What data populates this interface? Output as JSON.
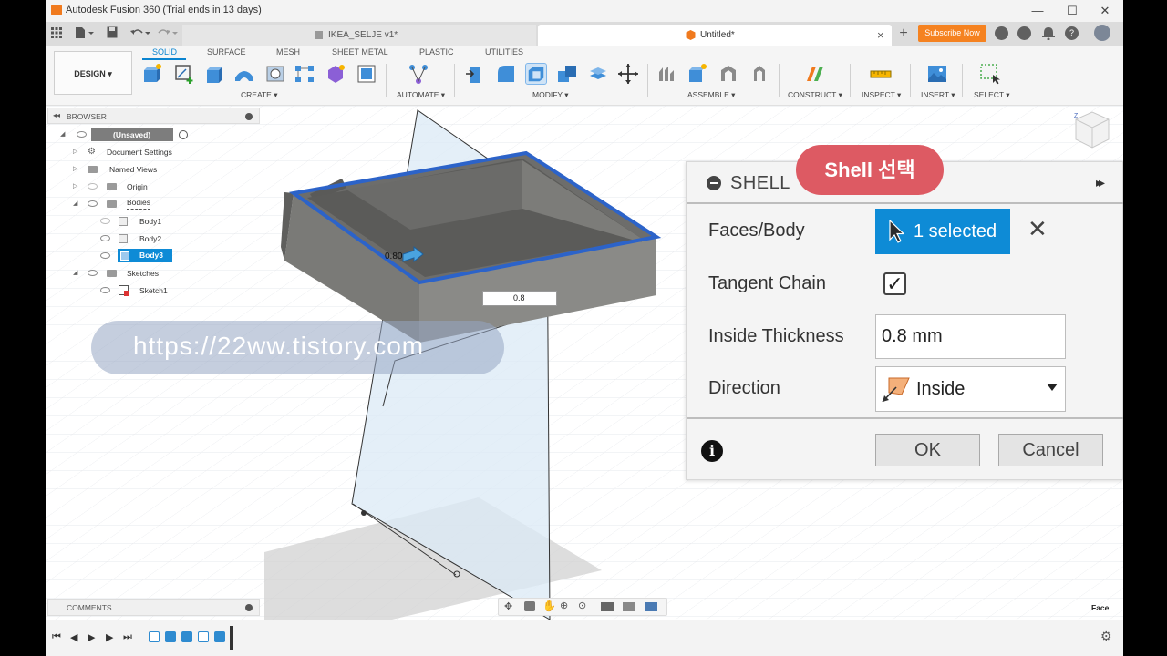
{
  "window": {
    "title": "Autodesk Fusion 360 (Trial ends in 13 days)",
    "controls": {
      "minimize": "—",
      "maximize": "☐",
      "close": "✕"
    }
  },
  "tabs": [
    {
      "label": "IKEA_SELJE v1*",
      "active": false
    },
    {
      "label": "Untitled*",
      "active": true
    }
  ],
  "tab_close": "×",
  "tab_add": "+",
  "subscribe_label": "Subscribe Now",
  "toolbar": {
    "design_label": "DESIGN ▾",
    "workspace_tabs": [
      "SOLID",
      "SURFACE",
      "MESH",
      "SHEET METAL",
      "PLASTIC",
      "UTILITIES"
    ],
    "groups": {
      "create": "CREATE ▾",
      "automate": "AUTOMATE ▾",
      "modify": "MODIFY ▾",
      "assemble": "ASSEMBLE ▾",
      "construct": "CONSTRUCT ▾",
      "inspect": "INSPECT ▾",
      "insert": "INSERT ▾",
      "select": "SELECT ▾"
    }
  },
  "browser": {
    "title": "BROWSER",
    "items": [
      {
        "label": "(Unsaved)"
      },
      {
        "label": "Document Settings"
      },
      {
        "label": "Named Views"
      },
      {
        "label": "Origin"
      },
      {
        "label": "Bodies"
      },
      {
        "label": "Body1"
      },
      {
        "label": "Body2"
      },
      {
        "label": "Body3",
        "selected": true
      },
      {
        "label": "Sketches"
      },
      {
        "label": "Sketch1"
      }
    ]
  },
  "comments_label": "COMMENTS",
  "watermark": "https://22ww.tistory.com",
  "annotation": "Shell 선택",
  "viewport": {
    "dimension_value": "0.8",
    "dimension_label": "0.80",
    "viewcube_face": "Face"
  },
  "dialog": {
    "title": "SHELL",
    "expand": "▸▸",
    "faces_label": "Faces/Body",
    "faces_value": "1 selected",
    "tangent_label": "Tangent Chain",
    "tangent_checked": "✓",
    "thickness_label": "Inside Thickness",
    "thickness_value": "0.8 mm",
    "direction_label": "Direction",
    "direction_value": "Inside",
    "info": "i",
    "ok": "OK",
    "cancel": "Cancel",
    "clear": "✕"
  },
  "timeline_controls": [
    "⏮",
    "◀",
    "▶",
    "▶",
    "⏭"
  ],
  "colors": {
    "accent": "#0e8bd6",
    "subscribe": "#f58220",
    "annotation": "#dd5a63",
    "shell_edge": "#2c63c9"
  }
}
